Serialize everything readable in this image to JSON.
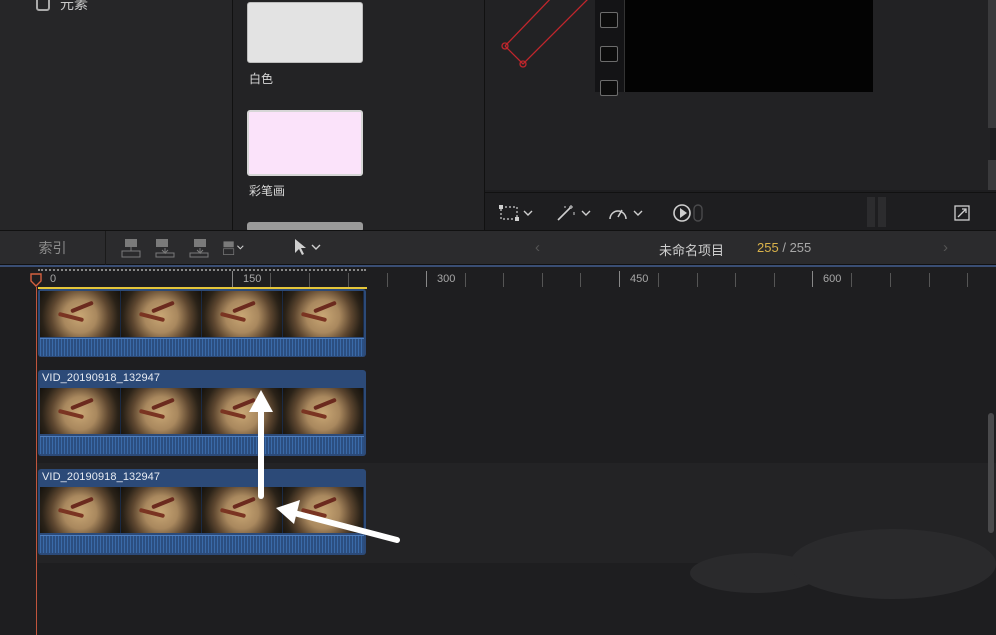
{
  "sidebar": {
    "element_label": "元素",
    "element_icon": "element-icon"
  },
  "browser": {
    "swatches": [
      {
        "label": "白色",
        "color": "#e3e3e3"
      },
      {
        "label": "彩笔画",
        "color": "#fbe3fa"
      }
    ]
  },
  "viewer": {
    "toolbar": {
      "transform_icon": "transform-icon",
      "enhance_icon": "magic-wand-icon",
      "speed_icon": "speed-gauge-icon",
      "playback_icon": "play-circle-icon",
      "fullscreen_icon": "fullscreen-icon"
    }
  },
  "timeline_header": {
    "index_tab": "索引",
    "prev": "‹",
    "next": "›",
    "project_name": "未命名项目",
    "frame_current": "255",
    "frame_separator": "/",
    "frame_total": "255"
  },
  "ruler": {
    "labels": [
      "0",
      "150",
      "300",
      "450",
      "600"
    ]
  },
  "clips": [
    {
      "name": "VID_20190918_132947"
    },
    {
      "name": "VID_20190918_132947"
    }
  ],
  "colors": {
    "accent_yellow": "#d9b24a",
    "clip_blue": "#2c4a78",
    "playhead_red": "#c0553d"
  }
}
